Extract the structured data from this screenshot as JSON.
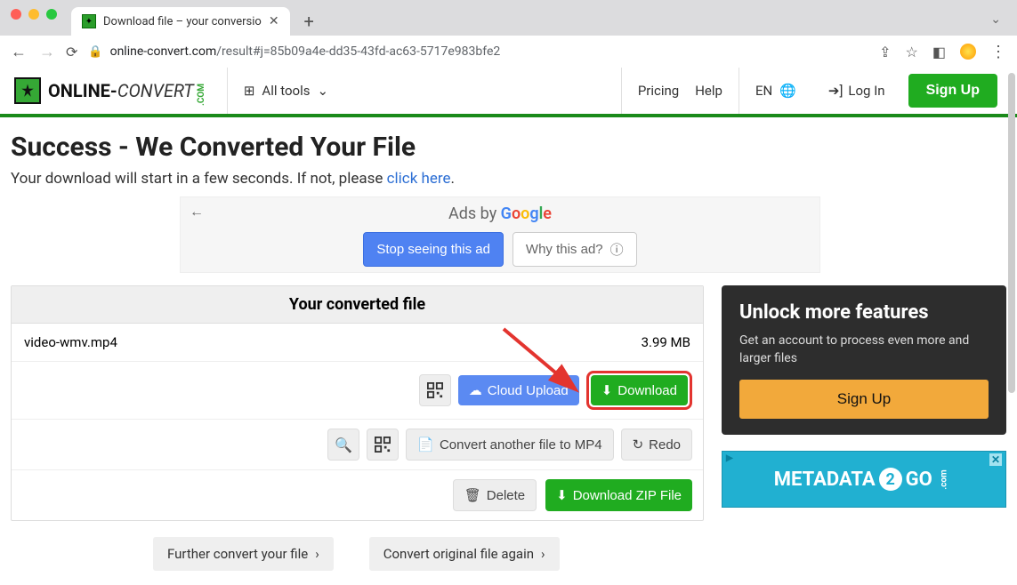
{
  "browser": {
    "tab_title": "Download file – your conversio",
    "url_host": "online-convert.com",
    "url_path": "/result#j=85b09a4e-dd35-43fd-ac63-5717e983bfe2"
  },
  "header": {
    "brand_a": "ONLINE-",
    "brand_b": "CONVERT",
    "brand_c": ".COM",
    "all_tools": "All tools",
    "pricing": "Pricing",
    "help": "Help",
    "lang": "EN",
    "login": "Log In",
    "signup": "Sign Up"
  },
  "page": {
    "heading": "Success - We Converted Your File",
    "sub_a": "Your download will start in a few seconds. If not, please ",
    "sub_link": "click here",
    "sub_b": "."
  },
  "ad": {
    "title_prefix": "Ads by ",
    "g": "Google",
    "stop": "Stop seeing this ad",
    "why": "Why this ad?"
  },
  "panel": {
    "title": "Your converted file",
    "filename": "video-wmv.mp4",
    "filesize": "3.99 MB",
    "cloud_upload": "Cloud Upload",
    "download": "Download",
    "convert_another": "Convert another file to MP4",
    "redo": "Redo",
    "delete": "Delete",
    "download_zip": "Download ZIP File"
  },
  "pills": {
    "further": "Further convert your file",
    "original": "Convert original file again"
  },
  "promo": {
    "title": "Unlock more features",
    "body": "Get an account to process even more and larger files",
    "signup": "Sign Up"
  },
  "banner": {
    "text_a": "METADATA",
    "text_b": "GO",
    "dotcom": ".com"
  }
}
